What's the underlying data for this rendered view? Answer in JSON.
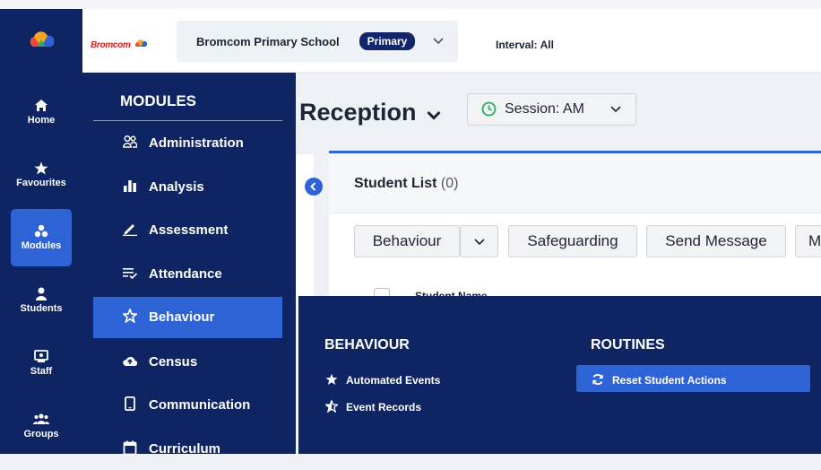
{
  "brand": {
    "logo_text": "Bromcom"
  },
  "rail": {
    "items": [
      {
        "label": "Home",
        "icon": "home-icon"
      },
      {
        "label": "Favourites",
        "icon": "star-icon"
      },
      {
        "label": "Modules",
        "icon": "modules-icon",
        "active": true
      },
      {
        "label": "Students",
        "icon": "student-icon"
      },
      {
        "label": "Staff",
        "icon": "staff-icon"
      },
      {
        "label": "Groups",
        "icon": "groups-icon"
      }
    ]
  },
  "header": {
    "school_name": "Bromcom Primary School",
    "school_type": "Primary",
    "interval": "Interval: All"
  },
  "main": {
    "class_name": "Reception",
    "session": "Session: AM",
    "student_list_title": "Student List",
    "student_count": "(0)",
    "actions": [
      "Behaviour",
      "Safeguarding",
      "Send Message",
      "M"
    ],
    "column_header": "Student Name"
  },
  "modules": {
    "title": "MODULES",
    "items": [
      {
        "label": "Administration",
        "icon": "people-icon"
      },
      {
        "label": "Analysis",
        "icon": "bar-chart-icon"
      },
      {
        "label": "Assessment",
        "icon": "pen-icon"
      },
      {
        "label": "Attendance",
        "icon": "list-check-icon"
      },
      {
        "label": "Behaviour",
        "icon": "star-outline-icon",
        "active": true
      },
      {
        "label": "Census",
        "icon": "cloud-upload-icon"
      },
      {
        "label": "Communication",
        "icon": "phone-icon"
      },
      {
        "label": "Curriculum",
        "icon": "calendar-icon"
      }
    ]
  },
  "flyout": {
    "behaviour_title": "BEHAVIOUR",
    "behaviour_items": [
      "Automated Events",
      "Event Records"
    ],
    "routines_title": "ROUTINES",
    "routines_items": [
      "Reset Student Actions"
    ]
  },
  "colors": {
    "navy": "#0f2463",
    "accent": "#2e63d6",
    "session_icon": "#27ae60"
  }
}
